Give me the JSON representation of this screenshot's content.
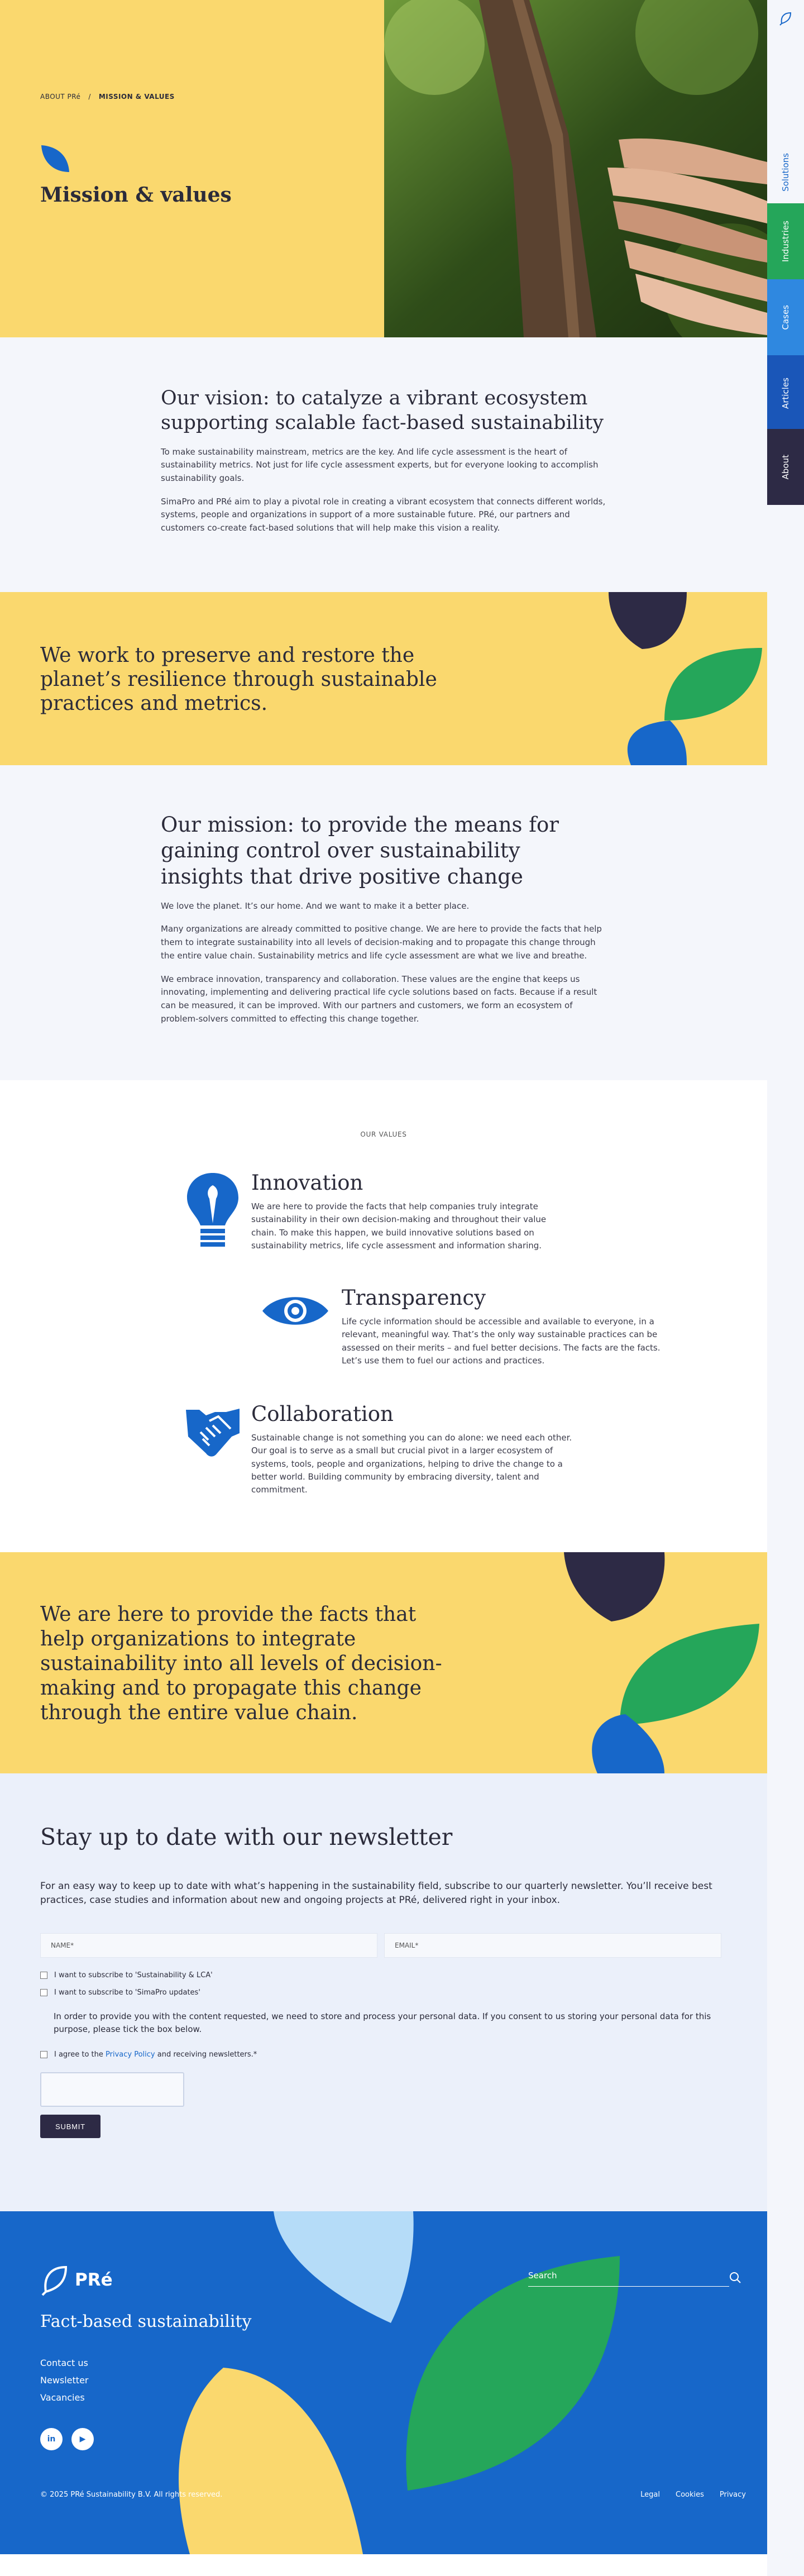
{
  "breadcrumb": {
    "parent": "ABOUT PRé",
    "separator": "/",
    "current": "MISSION & VALUES"
  },
  "hero": {
    "title": "Mission & values"
  },
  "sidenav": {
    "tabs": [
      {
        "label": "Solutions",
        "color": "#f4f6fb",
        "text": "#1767c9"
      },
      {
        "label": "Industries",
        "color": "#25a65a",
        "text": "#ffffff"
      },
      {
        "label": "Cases",
        "color": "#2f88e0",
        "text": "#ffffff"
      },
      {
        "label": "Articles",
        "color": "#1a56b8",
        "text": "#ffffff"
      },
      {
        "label": "About",
        "color": "#2d2a45",
        "text": "#ffffff"
      }
    ]
  },
  "vision": {
    "heading": "Our vision: to catalyze a vibrant ecosystem supporting scalable fact-based sustainability",
    "p1": "To make sustainability mainstream, metrics are the key. And life cycle assessment is the heart of sustainability metrics. Not just for life cycle assessment experts, but for everyone looking to accomplish sustainability goals.",
    "p2": "SimaPro and PRé aim to play a pivotal role in creating a vibrant ecosystem that connects different worlds, systems, people and organizations in support of a more sustainable future. PRé, our partners and customers co-create fact-based solutions that will help make this vision a reality."
  },
  "band1": {
    "quote": "We work to preserve and restore the planet’s resilience through sustainable practices and metrics."
  },
  "mission": {
    "heading": "Our mission: to provide the means for gaining control over sustainability insights that drive positive change",
    "p1": "We love the planet. It’s our home. And we want to make it a better place.",
    "p2": "Many organizations are already committed to positive change. We are here to provide the facts that help them to integrate sustainability into all levels of decision-making and to propagate this change through the entire value chain. Sustainability metrics and life cycle assessment are what we live and breathe.",
    "p3": "We embrace innovation, transparency and collaboration. These values are the engine that keeps us innovating, implementing and delivering practical life cycle solutions based on facts. Because if a result can be measured, it can be improved. With our partners and customers, we form an ecosystem of problem-solvers committed to effecting this change together."
  },
  "values": {
    "eyebrow": "OUR VALUES",
    "items": [
      {
        "icon": "lightbulb-icon",
        "title": "Innovation",
        "text": "We are here to provide the facts that help companies truly integrate sustainability in their own decision-making and throughout their value chain. To make this happen, we build innovative solutions based on sustainability metrics, life cycle assessment and information sharing."
      },
      {
        "icon": "eye-icon",
        "title": "Transparency",
        "text": "Life cycle information should be accessible and available to everyone, in a relevant, meaningful way. That’s the only way sustainable practices can be assessed on their merits – and fuel better decisions. The facts are the facts. Let’s use them to fuel our actions and practices."
      },
      {
        "icon": "handshake-icon",
        "title": "Collaboration",
        "text": "Sustainable change is not something you can do alone: we need each other. Our goal is to serve as a small but crucial pivot in a larger ecosystem of systems, tools, people and organizations, helping to drive the change to a better world. Building community by embracing diversity, talent and commitment."
      }
    ]
  },
  "band2": {
    "quote": "We are here to provide the facts that help organizations to integrate sustainability into all levels of decision-making and to propagate this change through the entire value chain."
  },
  "newsletter": {
    "heading": "Stay up to date with our newsletter",
    "intro": "For an easy way to keep up to date with what’s happening in the sustainability field, subscribe to our quarterly newsletter. You’ll receive best practices, case studies and information about new and ongoing projects at PRé, delivered right in your inbox.",
    "name_placeholder": "NAME*",
    "email_placeholder": "EMAIL*",
    "opt1": "I want to subscribe to 'Sustainability & LCA'",
    "opt2": "I want to subscribe to 'SimaPro updates'",
    "consent": "In order to provide you with the content requested, we need to store and process your personal data. If you consent to us storing your personal data for this purpose, please tick the box below.",
    "agree_prefix": "I agree to the",
    "agree_link": "Privacy Policy",
    "agree_suffix": "and receiving newsletters.*",
    "submit": "SUBMIT"
  },
  "footer": {
    "brand": "PRé",
    "tagline": "Fact-based sustainability",
    "links": [
      "Contact us",
      "Newsletter",
      "Vacancies"
    ],
    "search_placeholder": "Search",
    "social": [
      {
        "icon": "linkedin-icon",
        "glyph": "in"
      },
      {
        "icon": "youtube-icon",
        "glyph": "▶"
      }
    ],
    "copyright": "© 2025 PRé Sustainability B.V. All rights reserved.",
    "legal": [
      "Legal",
      "Cookies",
      "Privacy"
    ]
  },
  "colors": {
    "yellow": "#fad86e",
    "blue": "#1767c9",
    "green": "#25a65a",
    "dark": "#2d2a45",
    "light_blue": "#b5dcf8"
  }
}
